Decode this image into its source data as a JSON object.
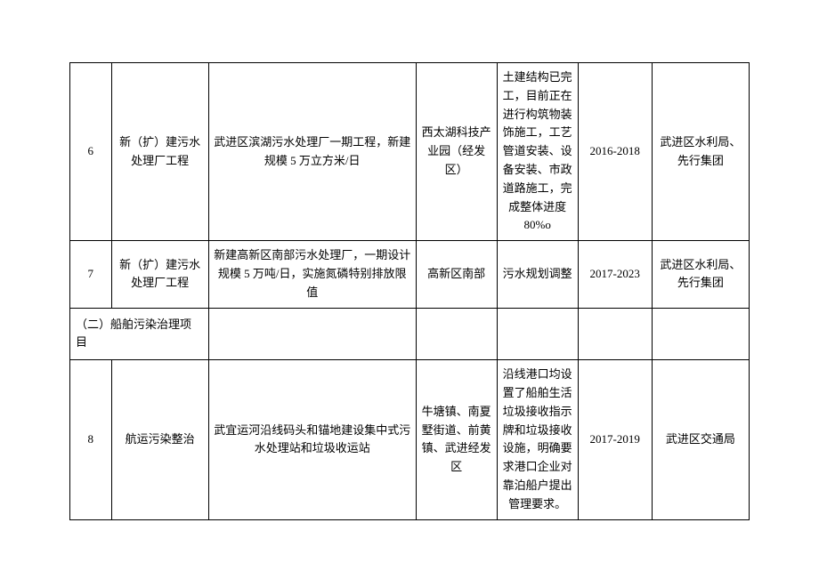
{
  "rows": [
    {
      "num": "6",
      "name": "新（扩）建污水处理厂工程",
      "desc": "武进区滨湖污水处理厂一期工程，新建规模 5 万立方米/日",
      "loc": "西太湖科技产业园（经发区）",
      "status": "土建结构已完工，目前正在进行构筑物装饰施工，工艺管道安装、设备安装、市政道路施工，完成整体进度80%o",
      "period": "2016-2018",
      "dept": "武进区水利局、先行集团"
    },
    {
      "num": "7",
      "name": "新（扩）建污水处理厂工程",
      "desc": "新建高新区南部污水处理厂，一期设计规模 5 万吨/日，实施氮磷特别排放限值",
      "loc": "高新区南部",
      "status": "污水规划调整",
      "period": "2017-2023",
      "dept": "武进区水利局、先行集团"
    }
  ],
  "section_header": "（二）船舶污染治理项目",
  "rows2": [
    {
      "num": "8",
      "name": "航运污染整治",
      "desc": "武宜运河沿线码头和锚地建设集中式污水处理站和垃圾收运站",
      "loc": "牛塘镇、南夏墅街道、前黄镇、武进经发区",
      "status": "沿线港口均设置了船舶生活垃圾接收指示牌和垃圾接收设施，明确要求港口企业对靠泊船户提出管理要求。",
      "period": "2017-2019",
      "dept": "武进区交通局"
    }
  ]
}
